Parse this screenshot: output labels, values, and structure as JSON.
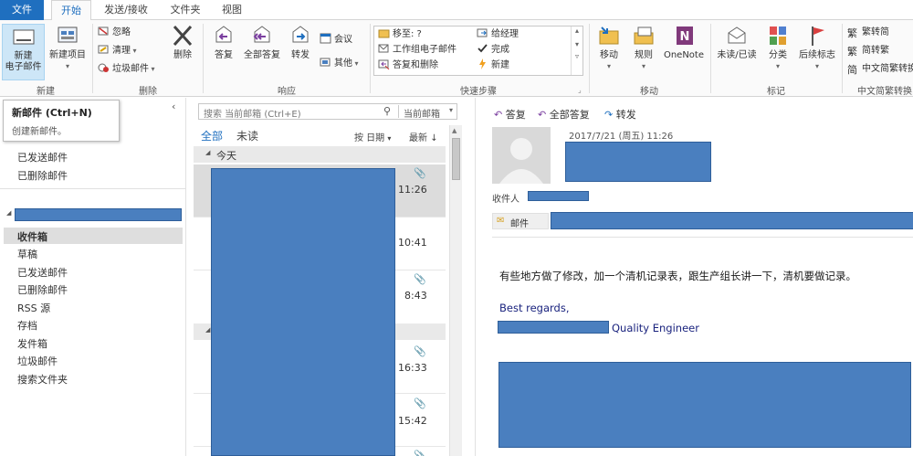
{
  "tabs": [
    "文件",
    "开始",
    "发送/接收",
    "文件夹",
    "视图"
  ],
  "ribbon": {
    "new_group": {
      "label": "新建",
      "new_email": "新建\n电子邮件",
      "new_items": "新建项目"
    },
    "delete_group": {
      "label": "删除",
      "ignore": "忽略",
      "clean_up": "清理",
      "junk": "垃圾邮件",
      "delete": "删除"
    },
    "respond_group": {
      "label": "响应",
      "reply": "答复",
      "reply_all": "全部答复",
      "forward": "转发",
      "meeting": "会议",
      "more": "其他"
    },
    "quick_steps": {
      "label": "快速步骤",
      "items": [
        "移至: ?",
        "给经理",
        "工作组电子邮件",
        "完成",
        "答复和删除",
        "新建"
      ]
    },
    "move_group": {
      "label": "移动",
      "move": "移动",
      "rules": "规则",
      "onenote": "OneNote"
    },
    "tags_group": {
      "label": "标记",
      "unread": "未读/已读",
      "categorize": "分类",
      "followup": "后续标志"
    },
    "chinese_group": {
      "label": "中文简繁转换",
      "t2s": "繁转简",
      "s2t": "简转繁",
      "convert": "中文简繁转换"
    }
  },
  "tooltip": {
    "title": "新邮件 (Ctrl+N)",
    "desc": "创建新邮件。"
  },
  "folders": {
    "top_items": [
      "已发送邮件",
      "已删除邮件"
    ],
    "items": [
      "收件箱",
      "草稿",
      "已发送邮件",
      "已删除邮件",
      "RSS 源",
      "存档",
      "发件箱",
      "垃圾邮件",
      "搜索文件夹"
    ]
  },
  "msglist": {
    "search_placeholder": "搜索 当前邮箱 (Ctrl+E)",
    "scope": "当前邮箱",
    "filter_all": "全部",
    "filter_unread": "未读",
    "sort_by": "按 日期",
    "order": "最新",
    "group_today": "今天",
    "times": [
      "11:26",
      "10:41",
      "8:43",
      "16:33",
      "15:42"
    ]
  },
  "reading": {
    "actions": {
      "reply": "答复",
      "reply_all": "全部答复",
      "forward": "转发"
    },
    "date": "2017/7/21 (周五) 11:26",
    "to_label": "收件人",
    "mail_label": "邮件",
    "body_line1": "有些地方做了修改，加一个清机记录表，跟生产组长讲一下，清机要做记录。",
    "regards": "Best regards,",
    "signature_title": "Quality Engineer"
  },
  "colors": {
    "accent": "#1f6fbf",
    "redaction": "#4a7fbf"
  }
}
